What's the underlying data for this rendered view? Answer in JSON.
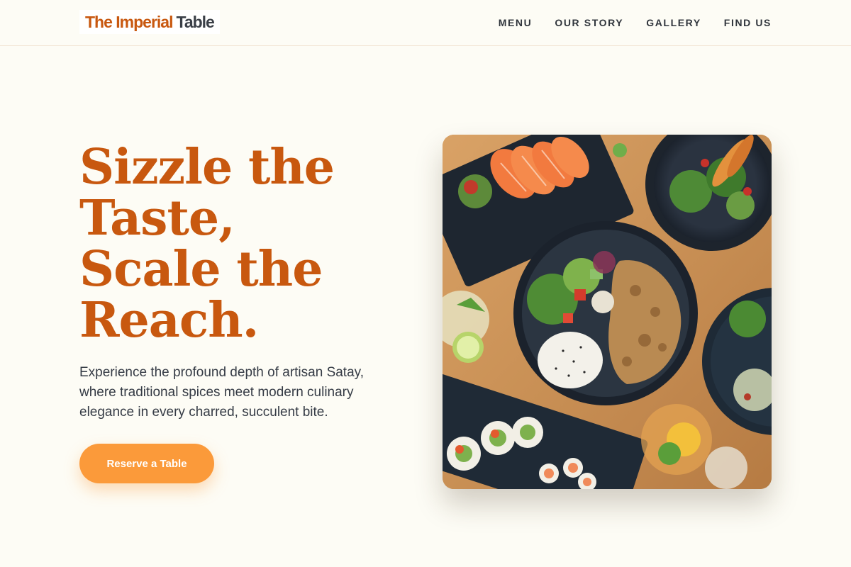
{
  "header": {
    "logo": {
      "part1": "The Imperial",
      "part2": "Table"
    },
    "nav": [
      {
        "label": "MENU"
      },
      {
        "label": "OUR STORY"
      },
      {
        "label": "GALLERY"
      },
      {
        "label": "FIND US"
      }
    ]
  },
  "hero": {
    "title_lines": [
      "Sizzle the",
      "Taste,",
      "Scale the",
      "Reach."
    ],
    "description": "Experience the profound depth of artisan Satay, where traditional spices meet modern culinary elegance in every charred, succulent bite.",
    "cta_label": "Reserve a Table",
    "image": {
      "icon": "food-spread-photo"
    }
  },
  "colors": {
    "background": "#fdfcf5",
    "accent": "#c8580f",
    "button": "#fb9a3a",
    "text": "#353b45"
  }
}
